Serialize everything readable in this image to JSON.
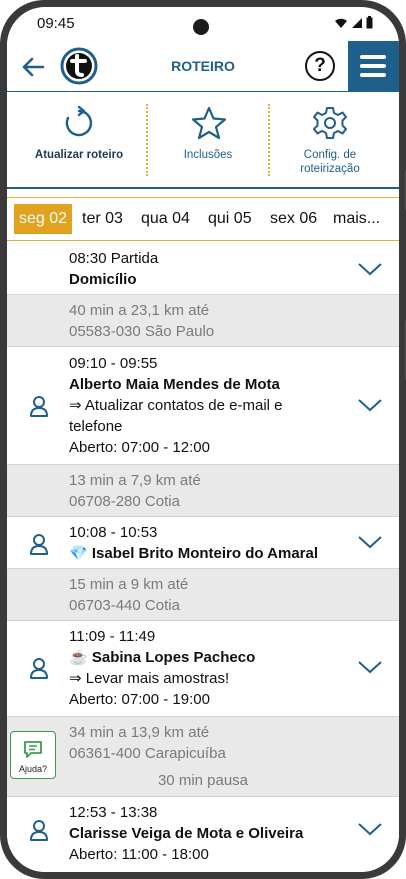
{
  "status": {
    "time": "09:45"
  },
  "header": {
    "title": "ROTEIRO",
    "help_label": "?"
  },
  "toolbar": {
    "refresh_label": "Atualizar roteiro",
    "inclusions_label": "Inclusões",
    "config_label_line1": "Config. de",
    "config_label_line2": "roteirização"
  },
  "days": [
    {
      "label": "seg 02"
    },
    {
      "label": "ter 03"
    },
    {
      "label": "qua 04"
    },
    {
      "label": "qui 05"
    },
    {
      "label": "sex 06"
    },
    {
      "label": "mais..."
    }
  ],
  "route": {
    "start": {
      "time": "08:30 Partida",
      "place": "Domicílio"
    },
    "leg1": {
      "distance": "40 min a 23,1 km até",
      "address": "05583-030 São Paulo"
    },
    "stop1": {
      "time": "09:10 - 09:55",
      "name": "Alberto Maia Mendes de Mota",
      "task_line1": "⇒ Atualizar contatos de e-mail e",
      "task_line2": "telefone",
      "hours": "Aberto: 07:00 - 12:00"
    },
    "leg2": {
      "distance": "13 min a 7,9 km até",
      "address": "06708-280 Cotia"
    },
    "stop2": {
      "time": "10:08 - 10:53",
      "badge": "💎",
      "name": "Isabel Brito Monteiro do Amaral"
    },
    "leg3": {
      "distance": "15 min a 9 km até",
      "address": "06703-440 Cotia"
    },
    "stop3": {
      "time": "11:09 - 11:49",
      "badge": "☕",
      "name": "Sabina Lopes Pacheco",
      "task": "⇒ Levar mais amostras!",
      "hours": "Aberto: 07:00 - 19:00"
    },
    "leg4": {
      "distance": "34 min a 13,9 km até",
      "address": "06361-400 Carapicuíba",
      "pause": "30 min pausa"
    },
    "stop4": {
      "time": "12:53 - 13:38",
      "name": "Clarisse Veiga de Mota e Oliveira",
      "hours": "Aberto: 11:00 - 18:00"
    }
  },
  "help_fab": {
    "label": "Ajuda?"
  },
  "colors": {
    "primary": "#1f5f8b",
    "accent": "#e0a21f",
    "help": "#3a9d4d"
  }
}
